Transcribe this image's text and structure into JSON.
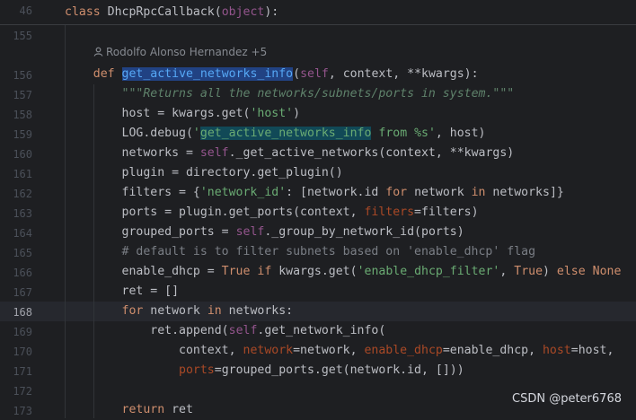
{
  "sticky_header": {
    "line_number": "46",
    "keyword": "class",
    "text": " DhcpRpcCallback(",
    "base": "object",
    "end": "):"
  },
  "author_hint": "Rodolfo Alonso Hernandez +5",
  "current_line": "168",
  "line_numbers": [
    "155",
    "156",
    "157",
    "158",
    "159",
    "160",
    "161",
    "162",
    "163",
    "164",
    "165",
    "166",
    "167",
    "168",
    "169",
    "170",
    "171",
    "172",
    "173"
  ],
  "code_lines": [
    {
      "n": "155",
      "tokens": []
    },
    {
      "n": "156",
      "tokens": [
        {
          "t": "    "
        },
        {
          "t": "def",
          "c": "kw"
        },
        {
          "t": " "
        },
        {
          "t": "get_active_networks_info",
          "c": "fn sel"
        },
        {
          "t": "("
        },
        {
          "t": "self",
          "c": "self"
        },
        {
          "t": ", context, **kwargs):"
        }
      ]
    },
    {
      "n": "157",
      "tokens": [
        {
          "t": "        "
        },
        {
          "t": "\"\"\"Returns all the networks/subnets/ports in system.\"\"\"",
          "c": "doc"
        }
      ]
    },
    {
      "n": "158",
      "tokens": [
        {
          "t": "        host = kwargs.get("
        },
        {
          "t": "'host'",
          "c": "str"
        },
        {
          "t": ")"
        }
      ]
    },
    {
      "n": "159",
      "tokens": [
        {
          "t": "        LOG.debug("
        },
        {
          "t": "'",
          "c": "str"
        },
        {
          "t": "get_active_networks_info",
          "c": "str hit"
        },
        {
          "t": " from %s'",
          "c": "str"
        },
        {
          "t": ", host)"
        }
      ]
    },
    {
      "n": "160",
      "tokens": [
        {
          "t": "        networks = "
        },
        {
          "t": "self",
          "c": "self"
        },
        {
          "t": "._get_active_networks(context, **kwargs)"
        }
      ]
    },
    {
      "n": "161",
      "tokens": [
        {
          "t": "        plugin = directory.get_plugin()"
        }
      ]
    },
    {
      "n": "162",
      "tokens": [
        {
          "t": "        filters = {"
        },
        {
          "t": "'network_id'",
          "c": "str"
        },
        {
          "t": ": [network.id "
        },
        {
          "t": "for",
          "c": "kw"
        },
        {
          "t": " network "
        },
        {
          "t": "in",
          "c": "kw"
        },
        {
          "t": " networks]}"
        }
      ]
    },
    {
      "n": "163",
      "tokens": [
        {
          "t": "        ports = plugin.get_ports(context, "
        },
        {
          "t": "filters",
          "c": "named"
        },
        {
          "t": "=filters)"
        }
      ]
    },
    {
      "n": "164",
      "tokens": [
        {
          "t": "        grouped_ports = "
        },
        {
          "t": "self",
          "c": "self"
        },
        {
          "t": "._group_by_network_id(ports)"
        }
      ]
    },
    {
      "n": "165",
      "tokens": [
        {
          "t": "        # default is to filter subnets based on 'enable_dhcp' flag",
          "c": "cmt"
        }
      ]
    },
    {
      "n": "166",
      "tokens": [
        {
          "t": "        enable_dhcp = "
        },
        {
          "t": "True",
          "c": "kw"
        },
        {
          "t": " "
        },
        {
          "t": "if",
          "c": "kw"
        },
        {
          "t": " kwargs.get("
        },
        {
          "t": "'enable_dhcp_filter'",
          "c": "str"
        },
        {
          "t": ", "
        },
        {
          "t": "True",
          "c": "kw"
        },
        {
          "t": ") "
        },
        {
          "t": "else",
          "c": "kw"
        },
        {
          "t": " "
        },
        {
          "t": "None",
          "c": "kw"
        }
      ]
    },
    {
      "n": "167",
      "tokens": [
        {
          "t": "        ret = []"
        }
      ]
    },
    {
      "n": "168",
      "tokens": [
        {
          "t": "        "
        },
        {
          "t": "for",
          "c": "kw"
        },
        {
          "t": " network "
        },
        {
          "t": "in",
          "c": "kw"
        },
        {
          "t": " networks:"
        }
      ]
    },
    {
      "n": "169",
      "tokens": [
        {
          "t": "            ret.append("
        },
        {
          "t": "self",
          "c": "self"
        },
        {
          "t": ".get_network_info("
        }
      ]
    },
    {
      "n": "170",
      "tokens": [
        {
          "t": "                context, "
        },
        {
          "t": "network",
          "c": "named"
        },
        {
          "t": "=network, "
        },
        {
          "t": "enable_dhcp",
          "c": "named"
        },
        {
          "t": "=enable_dhcp, "
        },
        {
          "t": "host",
          "c": "named"
        },
        {
          "t": "=host,"
        }
      ]
    },
    {
      "n": "171",
      "tokens": [
        {
          "t": "                "
        },
        {
          "t": "ports",
          "c": "named"
        },
        {
          "t": "=grouped_ports.get(network.id, []))"
        }
      ]
    },
    {
      "n": "172",
      "tokens": []
    },
    {
      "n": "173",
      "tokens": [
        {
          "t": "        "
        },
        {
          "t": "return",
          "c": "kw"
        },
        {
          "t": " ret"
        }
      ]
    }
  ],
  "watermark": "CSDN @peter6768",
  "colors": {
    "background": "#1e1f22",
    "keyword": "#cf8e6d",
    "function": "#56a8f5",
    "string": "#6aab73",
    "self": "#94558d",
    "named_arg": "#aa4926",
    "comment": "#7a7e85"
  }
}
